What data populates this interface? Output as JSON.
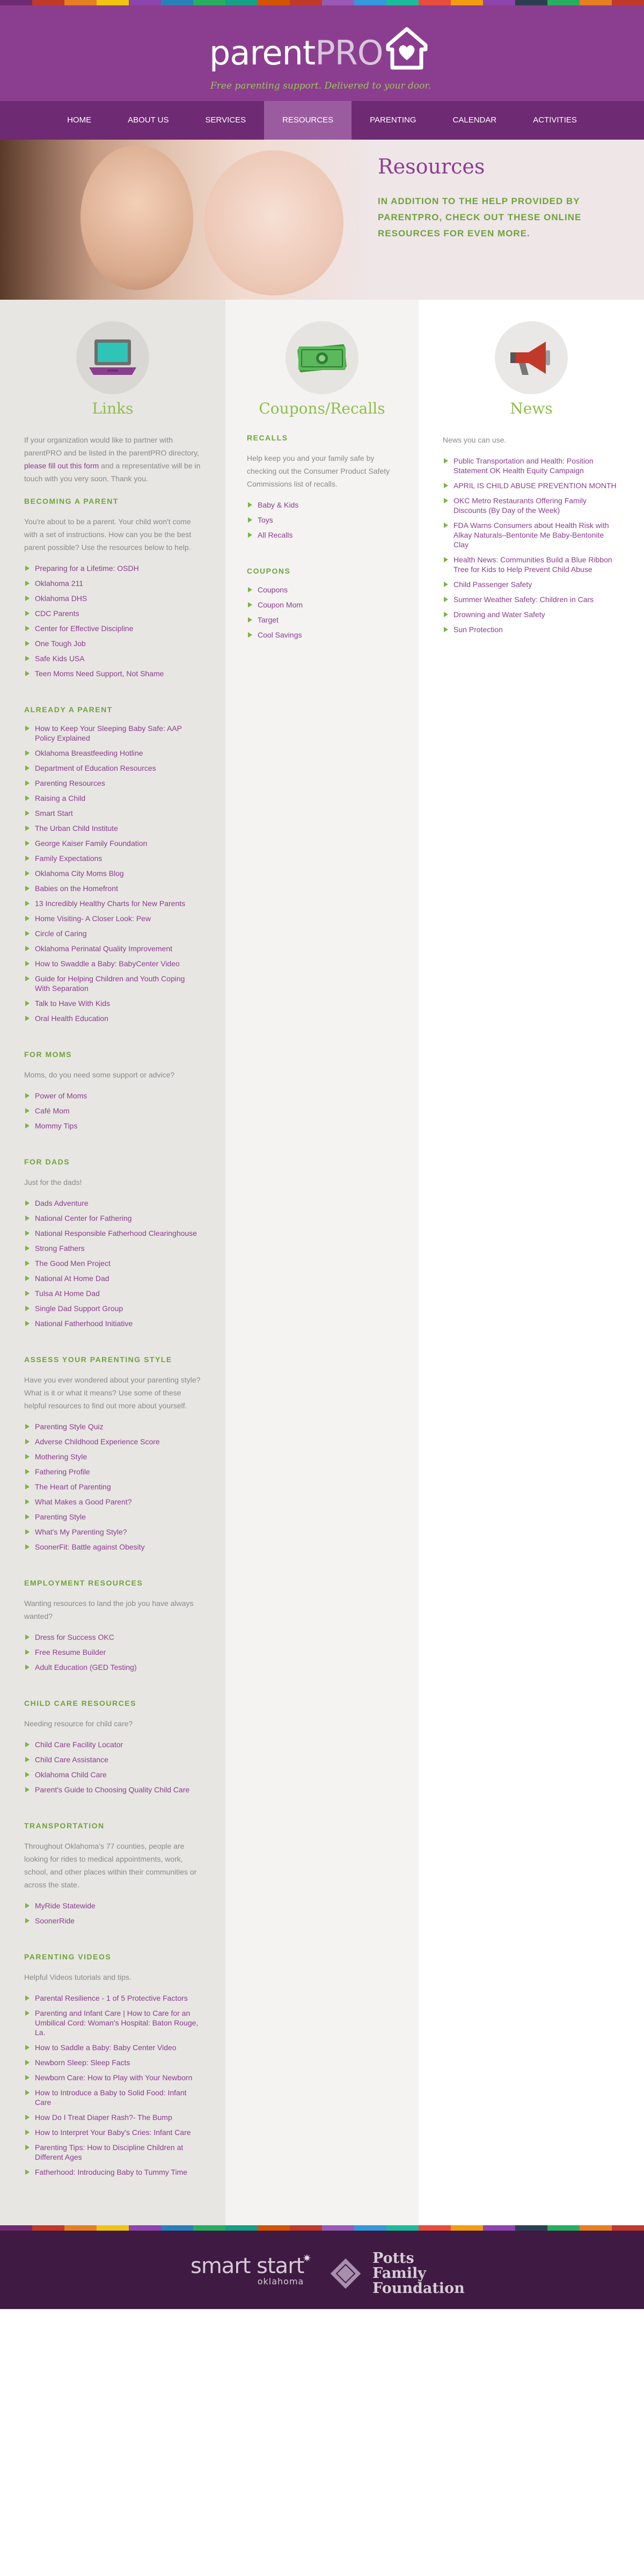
{
  "colors": {
    "brand_purple": "#8b3e8f",
    "nav_purple": "#6e2a72",
    "accent_green": "#8cbf4a",
    "footer_bg": "#3f1a42"
  },
  "stripe_colors": [
    "#6e2a72",
    "#c0392b",
    "#e67e22",
    "#f1c40f",
    "#8e44ad",
    "#2980b9",
    "#27ae60",
    "#16a085",
    "#d35400",
    "#c0392b",
    "#9b59b6",
    "#3498db",
    "#1abc9c",
    "#e74c3c",
    "#f39c12",
    "#8e44ad",
    "#2c3e50",
    "#27ae60",
    "#e67e22",
    "#c0392b"
  ],
  "header": {
    "logo_word_main": "parent",
    "logo_word_pro": "PRO",
    "tagline": "Free parenting support. Delivered to your door."
  },
  "nav": {
    "items": [
      {
        "label": "HOME"
      },
      {
        "label": "ABOUT US"
      },
      {
        "label": "SERVICES"
      },
      {
        "label": "RESOURCES"
      },
      {
        "label": "PARENTING"
      },
      {
        "label": "CALENDAR"
      },
      {
        "label": "ACTIVITIES"
      }
    ],
    "active": "RESOURCES"
  },
  "hero": {
    "title": "Resources",
    "subtitle": "IN ADDITION TO THE HELP PROVIDED BY PARENTPRO, CHECK OUT THESE ONLINE RESOURCES FOR EVEN MORE."
  },
  "links_col": {
    "icon": "laptop-icon",
    "title": "Links",
    "intro_pre": "If your organization would like to partner with parentPRO and be listed in the parentPRO directory, ",
    "intro_link": "please fill out this form",
    "intro_post": " and a representative will be in touch with you very soon. Thank you.",
    "sections": [
      {
        "heading": "BECOMING A PARENT",
        "desc": "You're about to be a parent. Your child won't come with a set of instructions. How can you be the best parent possible? Use the resources below to help.",
        "items": [
          "Preparing for a Lifetime: OSDH",
          "Oklahoma 211",
          "Oklahoma DHS",
          "CDC Parents",
          "Center for Effective Discipline",
          "One Tough Job",
          "Safe Kids USA",
          "Teen Moms Need Support, Not Shame"
        ]
      },
      {
        "heading": "ALREADY A PARENT",
        "desc": "",
        "items": [
          "How to Keep Your Sleeping Baby Safe: AAP Policy Explained",
          "Oklahoma Breastfeeding Hotline",
          "Department of Education Resources",
          "Parenting Resources",
          "Raising a Child",
          "Smart Start",
          "The Urban Child Institute",
          "George Kaiser Family Foundation",
          "Family Expectations",
          "Oklahoma City Moms Blog",
          "Babies on the Homefront",
          "13 Incredibly Healthy Charts for New Parents",
          "Home Visiting- A Closer Look: Pew",
          "Circle of Caring",
          "Oklahoma Perinatal Quality Improvement",
          "How to Swaddle a Baby: BabyCenter Video",
          "Guide for Helping Children and Youth Coping With Separation",
          "Talk to Have With Kids",
          "Oral Health Education"
        ]
      },
      {
        "heading": "FOR MOMS",
        "desc": "Moms, do you need some support or advice?",
        "items": [
          "Power of Moms",
          "Café Mom",
          "Mommy Tips"
        ]
      },
      {
        "heading": "FOR DADS",
        "desc": "Just for the dads!",
        "items": [
          "Dads Adventure",
          "National Center for Fathering",
          "National Responsible Fatherhood Clearinghouse",
          "Strong Fathers",
          "The Good Men Project",
          "National At Home Dad",
          "Tulsa At Home Dad",
          "Single Dad Support Group",
          "National Fatherhood Initiative"
        ]
      },
      {
        "heading": "ASSESS YOUR PARENTING STYLE",
        "desc": "Have you ever wondered about your parenting style? What is it or what it means? Use some of these helpful resources to find out more about yourself.",
        "items": [
          "Parenting Style Quiz",
          "Adverse Childhood Experience Score",
          "Mothering Style",
          "Fathering Profile",
          "The Heart of Parenting",
          "What Makes a Good Parent?",
          "Parenting Style",
          "What's My Parenting Style?",
          "SoonerFit: Battle against Obesity"
        ]
      },
      {
        "heading": "EMPLOYMENT RESOURCES",
        "desc": "Wanting resources to land the job you have always wanted?",
        "items": [
          "Dress for Success OKC",
          "Free Resume Builder",
          "Adult Education (GED Testing)"
        ]
      },
      {
        "heading": "CHILD CARE RESOURCES",
        "desc": "Needing resource for child care?",
        "items": [
          "Child Care Facility Locator",
          "Child Care Assistance",
          "Oklahoma Child Care",
          "Parent's Guide to Choosing Quality Child Care"
        ]
      },
      {
        "heading": "TRANSPORTATION",
        "desc": "Throughout Oklahoma's 77 counties, people are looking for rides to medical appointments, work, school, and other places within their communities or across the state.",
        "items": [
          "MyRide Statewide",
          "SoonerRide"
        ]
      },
      {
        "heading": "PARENTING VIDEOS",
        "desc": "Helpful Videos tutorials and tips.",
        "items": [
          "Parental Resilience - 1 of 5 Protective Factors",
          "Parenting and Infant Care | How to Care for an Umbilical Cord: Woman's Hospital: Baton Rouge, La.",
          "How to Saddle a Baby: Baby Center Video",
          "Newborn Sleep: Sleep Facts",
          "Newborn Care: How to Play with Your Newborn",
          "How to Introduce a Baby to Solid Food: Infant Care",
          "How Do I Treat Diaper Rash?- The Bump",
          "How to Interpret Your Baby's Cries: Infant Care",
          "Parenting Tips: How to Discipline Children at Different Ages",
          "Fatherhood: Introducing Baby to Tummy Time"
        ]
      }
    ]
  },
  "coupons_col": {
    "icon": "money-icon",
    "title": "Coupons/Recalls",
    "sections": [
      {
        "heading": "RECALLS",
        "desc": "Help keep you and your family safe by checking out the Consumer Product Safety Commissions list of recalls.",
        "items": [
          "Baby & Kids",
          "Toys",
          "All Recalls"
        ]
      },
      {
        "heading": "COUPONS",
        "desc": "",
        "items": [
          "Coupons",
          "Coupon Mom",
          "Target",
          "Cool Savings"
        ]
      }
    ]
  },
  "news_col": {
    "icon": "megaphone-icon",
    "title": "News",
    "intro": "News you can use.",
    "items": [
      "Public Transportation and Health: Position Statement OK Health Equity Campaign",
      "APRIL IS CHILD ABUSE PREVENTION MONTH",
      "OKC Metro Restaurants Offering Family Discounts (By Day of the Week)",
      "FDA Warns Consumers about Health Risk with Alkay Naturals–Bentonite Me Baby-Bentonite Clay",
      "Health News: Communities Build a Blue Ribbon Tree for Kids to Help Prevent Child Abuse",
      "Child Passenger Safety",
      "Summer Weather Safety: Children in Cars",
      "Drowning and Water Safety",
      "Sun Protection"
    ]
  },
  "footer": {
    "smart_start_1": "smart start",
    "smart_start_2": "oklahoma",
    "potts_1": "Potts",
    "potts_2": "Family",
    "potts_3": "Foundation"
  }
}
